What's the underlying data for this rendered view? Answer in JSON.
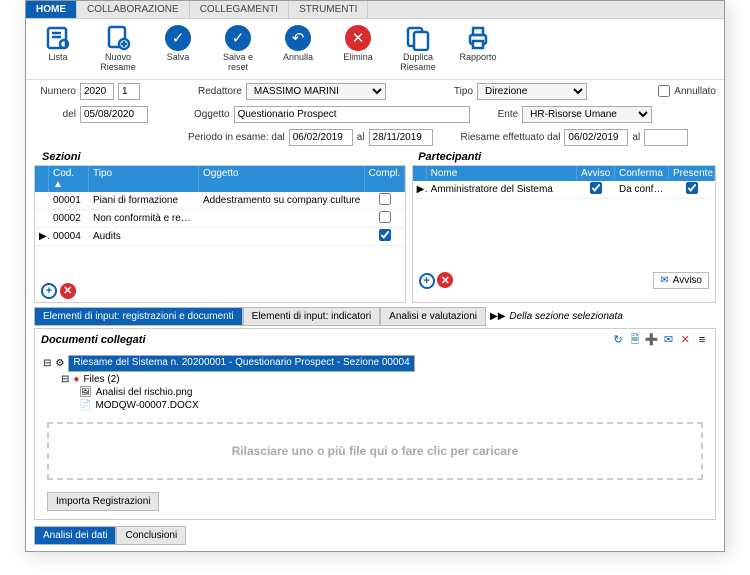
{
  "top_tabs": {
    "home": "HOME",
    "collab": "COLLABORAZIONE",
    "colleg": "COLLEGAMENTI",
    "strum": "STRUMENTI"
  },
  "toolbar": {
    "lista": "Lista",
    "nuovo": "Nuovo Riesame",
    "salva": "Salva",
    "salva_reset": "Salva e reset",
    "annulla": "Annulla",
    "elimina": "Elimina",
    "duplica": "Duplica Riesame",
    "rapporto": "Rapporto"
  },
  "form": {
    "numero_lbl": "Numero",
    "anno": "2020",
    "seq": "1",
    "del_lbl": "del",
    "del_date": "05/08/2020",
    "redattore_lbl": "Redattore",
    "redattore": "MASSIMO MARINI",
    "tipo_lbl": "Tipo",
    "tipo": "Direzione",
    "annullato_lbl": "Annullato",
    "oggetto_lbl": "Oggetto",
    "oggetto": "Questionario Prospect",
    "ente_lbl": "Ente",
    "ente": "HR-Risorse Umane",
    "periodo_lbl": "Periodo in esame: dal",
    "periodo_dal": "06/02/2019",
    "al_lbl": "al",
    "periodo_al": "28/11/2019",
    "riesame_lbl": "Riesame effettuato dal",
    "riesame_dal": "06/02/2019",
    "riesame_al": ""
  },
  "sezioni": {
    "title": "Sezioni",
    "cols": {
      "cod": "Cod.",
      "tipo": "Tipo",
      "oggetto": "Oggetto",
      "compl": "Compl."
    },
    "rows": [
      {
        "cod": "00001",
        "tipo": "Piani di formazione",
        "oggetto": "Addestramento su company culture",
        "compl": false,
        "sel": false
      },
      {
        "cod": "00002",
        "tipo": "Non conformità e recl...",
        "oggetto": "",
        "compl": false,
        "sel": false
      },
      {
        "cod": "00004",
        "tipo": "Audits",
        "oggetto": "",
        "compl": true,
        "sel": true
      }
    ]
  },
  "partecipanti": {
    "title": "Partecipanti",
    "cols": {
      "nome": "Nome",
      "avviso": "Avviso",
      "conferma": "Conferma",
      "presente": "Presente"
    },
    "rows": [
      {
        "nome": "Amministratore del Sistema",
        "avviso": true,
        "conferma": "Da conferm...",
        "presente": true,
        "sel": true
      }
    ],
    "avviso_btn": "Avviso"
  },
  "subtabs": {
    "t1": "Elementi di input: registrazioni e documenti",
    "t2": "Elementi di input: indicatori",
    "t3": "Analisi e valutazioni",
    "suffix": "Della sezione selezionata"
  },
  "docs": {
    "title": "Documenti collegati",
    "root": "Riesame del Sistema n. 20200001 - Questionario Prospect - Sezione 00004",
    "files_label": "Files (2)",
    "files": [
      "Analisi del rischio.png",
      "MODQW-00007.DOCX"
    ],
    "dropzone": "Rilasciare uno o più file qui o fare clic per caricare",
    "import_btn": "Importa Registrazioni"
  },
  "bottom_tabs": {
    "analisi": "Analisi dei dati",
    "conclusioni": "Conclusioni"
  }
}
